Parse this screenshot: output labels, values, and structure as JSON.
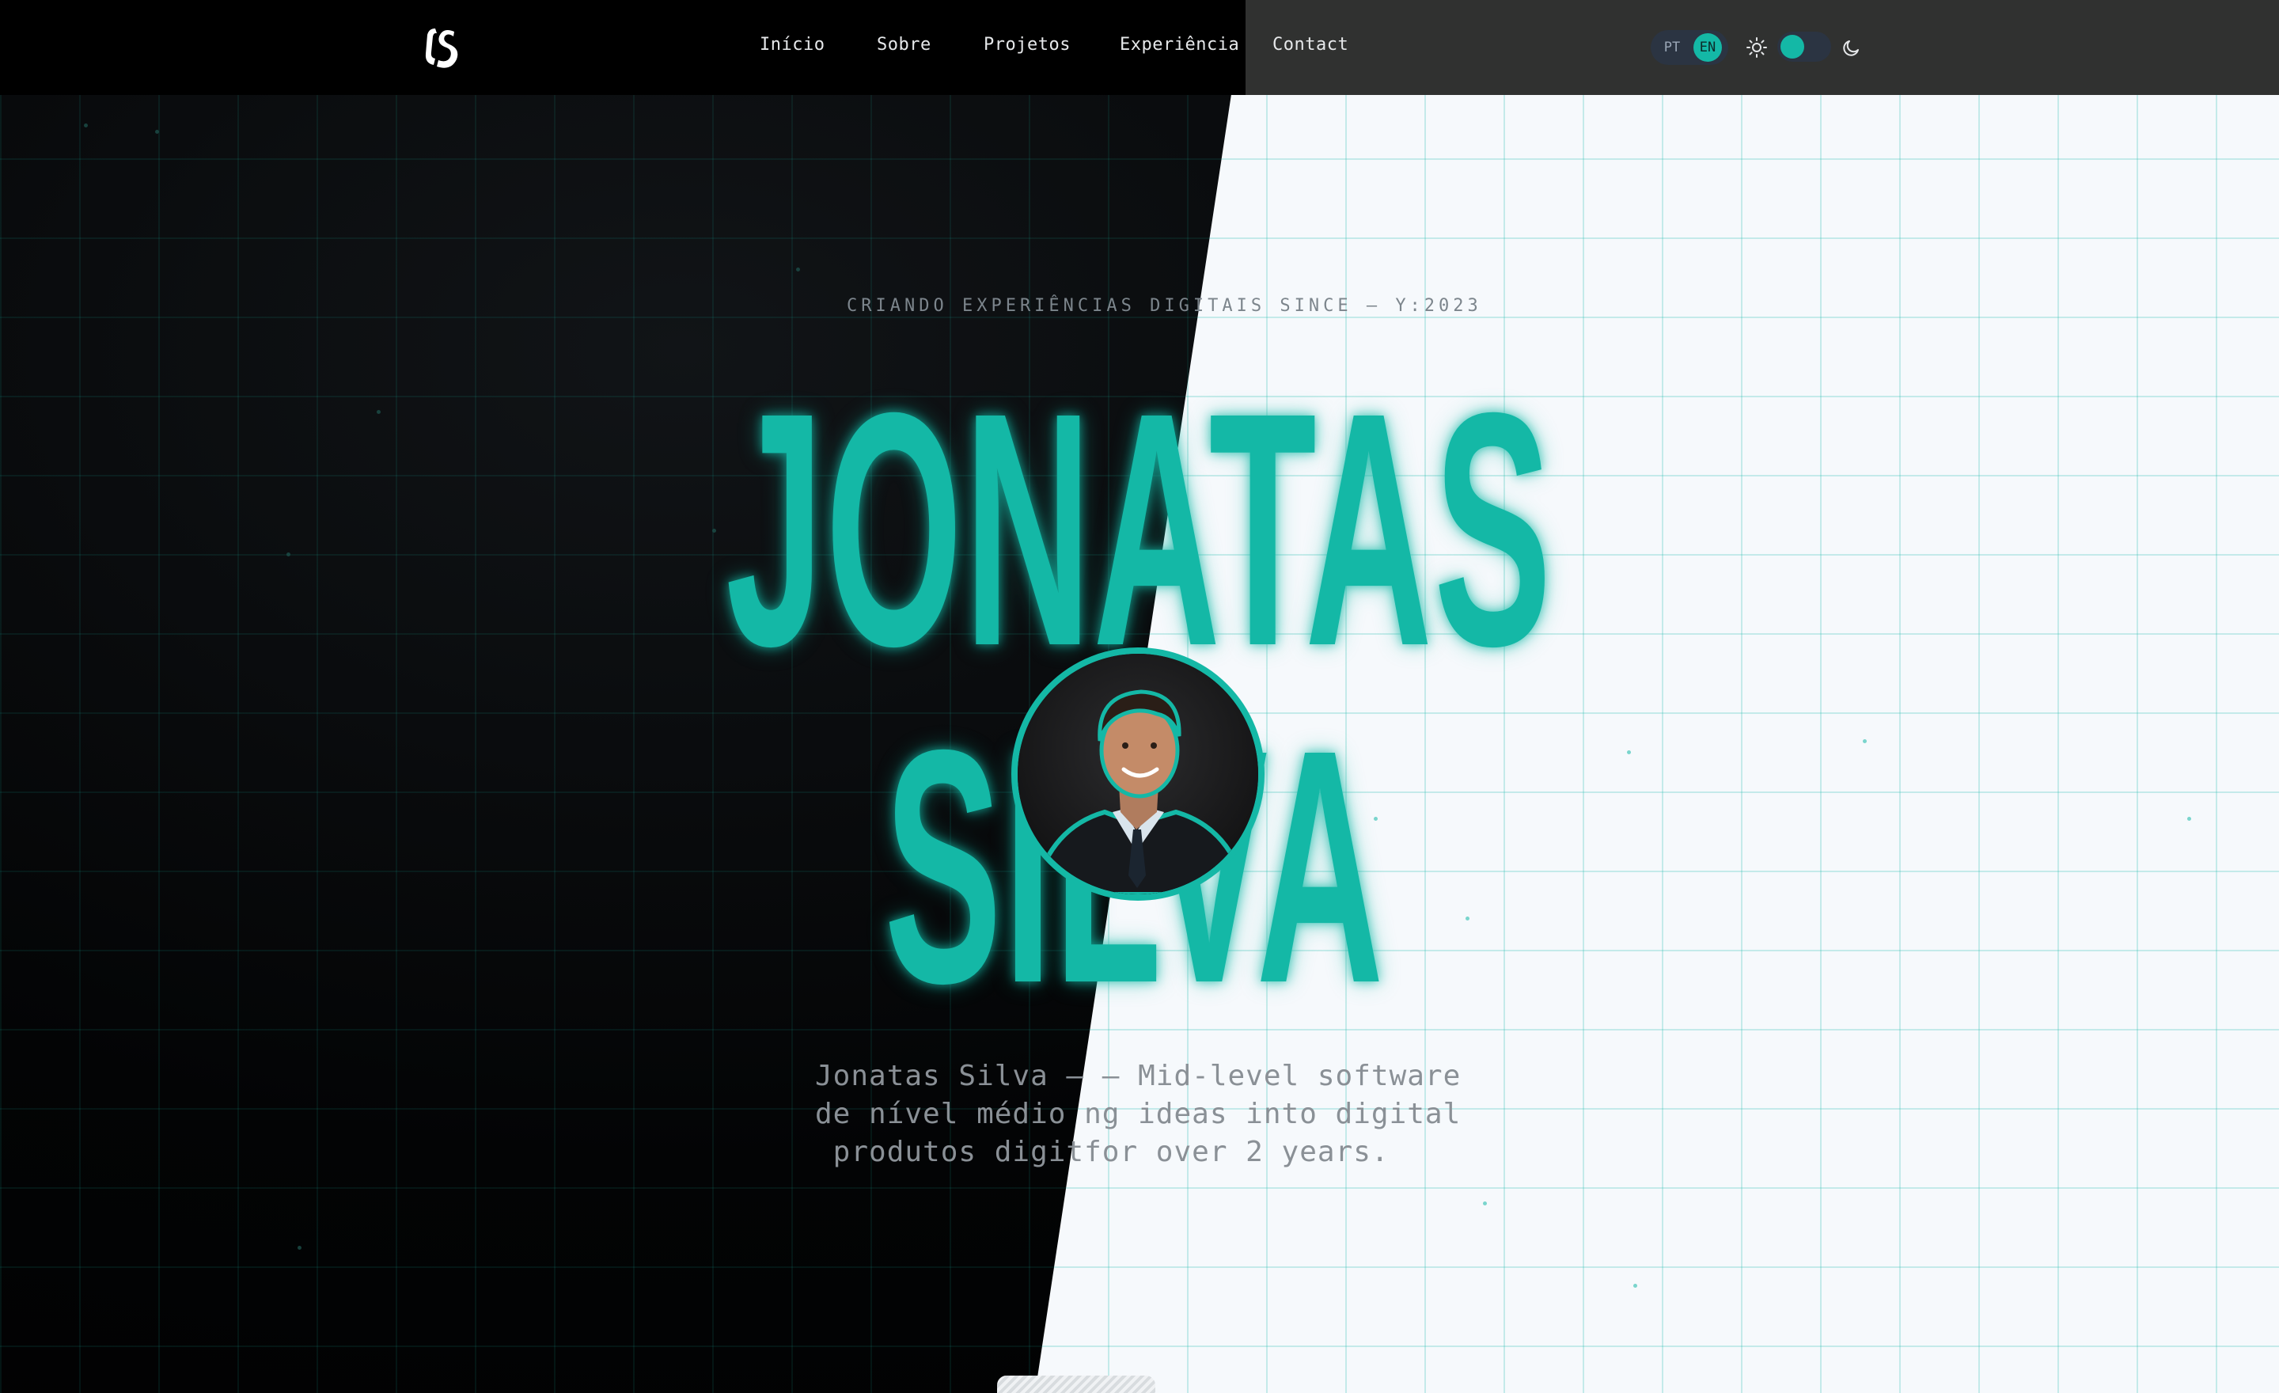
{
  "nav": {
    "logo_alt": "JS",
    "links": [
      "Início",
      "Sobre",
      "Projetos",
      "Experiência",
      "Contact"
    ],
    "lang": {
      "pt": "PT",
      "en": "EN",
      "active": "EN"
    },
    "theme_toggle": {
      "state": "light",
      "sun_icon": "sun-icon",
      "moon_icon": "moon-icon"
    }
  },
  "hero": {
    "tagline": "CRIANDO EXPERIÊNCIAS DIGITAIS SINCE — Y:2023",
    "name_line1": "JONATAS",
    "name_line2": "SILVA",
    "avatar_alt": "Jonatas Silva",
    "description_lines": [
      "Jonatas Silva — — Mid-level software",
      "de nível médio ng ideas into digital",
      " produtos digitfor over 2 years."
    ]
  },
  "colors": {
    "accent": "#14b8a6",
    "dark_bg": "#000000",
    "light_bg": "#f6f9fc",
    "nav_right": "#303130"
  }
}
